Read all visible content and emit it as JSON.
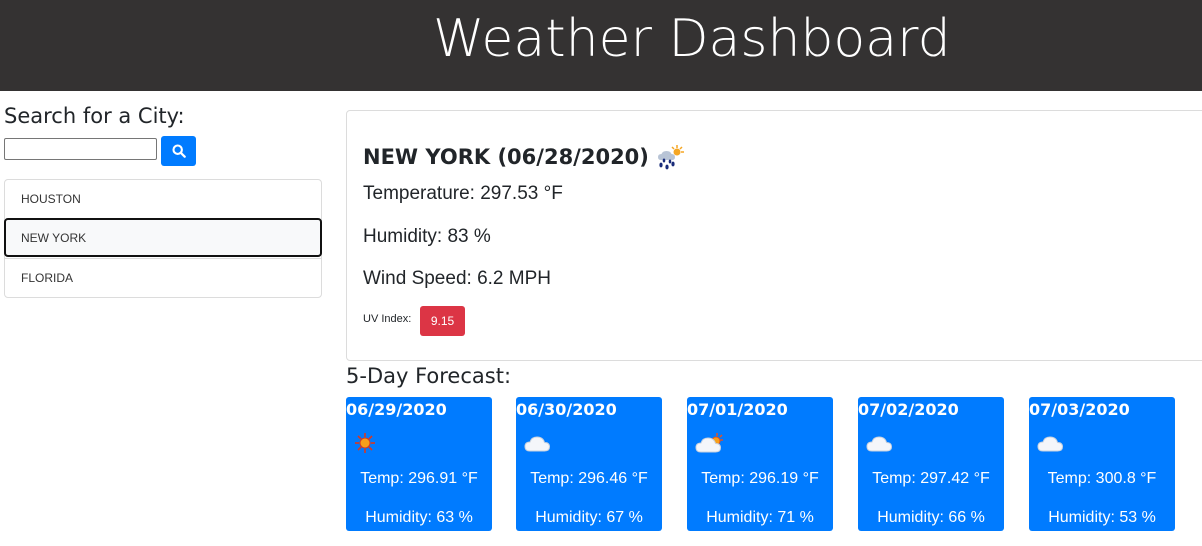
{
  "header": {
    "title": "Weather Dashboard"
  },
  "search": {
    "label": "Search for a City:",
    "value": "",
    "button_icon": "search-icon"
  },
  "cities": [
    {
      "name": "HOUSTON",
      "active": false
    },
    {
      "name": "NEW YORK",
      "active": true
    },
    {
      "name": "FLORIDA",
      "active": false
    }
  ],
  "current": {
    "title": "NEW YORK (06/28/2020)",
    "icon": "rain-sun-icon",
    "temperature": "Temperature: 297.53 °F",
    "humidity": "Humidity: 83 %",
    "wind": "Wind Speed: 6.2 MPH",
    "uv_label": "UV Index:",
    "uv_value": "9.15"
  },
  "forecast": {
    "title": "5-Day Forecast:",
    "days": [
      {
        "date": "06/29/2020",
        "icon": "sun-icon",
        "temp": "Temp: 296.91 °F",
        "humidity": "Humidity: 63 %"
      },
      {
        "date": "06/30/2020",
        "icon": "cloud-icon",
        "temp": "Temp: 296.46 °F",
        "humidity": "Humidity: 67 %"
      },
      {
        "date": "07/01/2020",
        "icon": "partly-cloudy-icon",
        "temp": "Temp: 296.19 °F",
        "humidity": "Humidity: 71 %"
      },
      {
        "date": "07/02/2020",
        "icon": "cloud-icon",
        "temp": "Temp: 297.42 °F",
        "humidity": "Humidity: 66 %"
      },
      {
        "date": "07/03/2020",
        "icon": "cloud-icon",
        "temp": "Temp: 300.8 °F",
        "humidity": "Humidity: 53 %"
      }
    ]
  },
  "colors": {
    "header_bg": "#343232",
    "accent": "#007bff",
    "uv_badge": "#dc3545"
  }
}
